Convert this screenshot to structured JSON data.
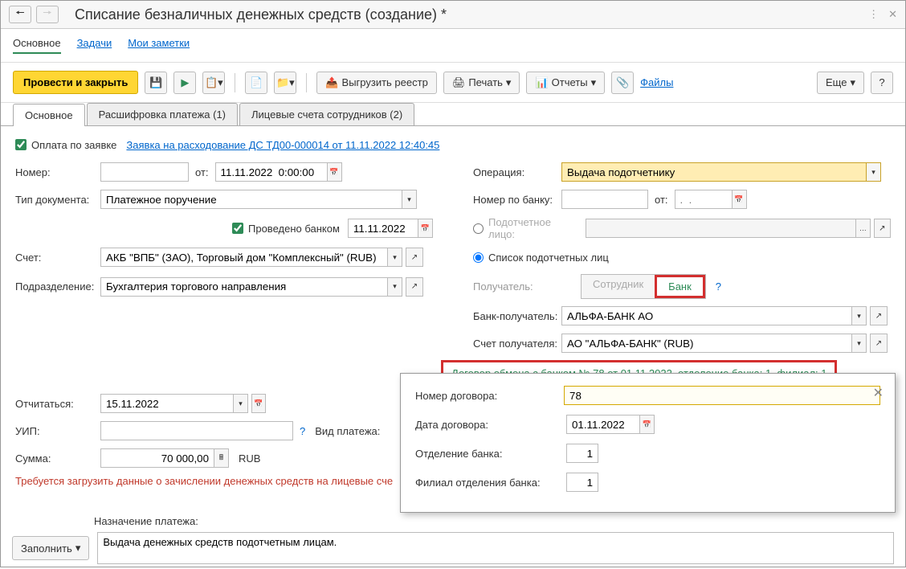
{
  "title": "Списание безналичных денежных средств (создание) *",
  "menu": {
    "main": "Основное",
    "tasks": "Задачи",
    "notes": "Мои заметки"
  },
  "toolbar": {
    "post_close": "Провести и закрыть",
    "export_registry": "Выгрузить реестр",
    "print": "Печать",
    "reports": "Отчеты",
    "files": "Файлы",
    "more": "Еще",
    "help": "?"
  },
  "tabs": {
    "main": "Основное",
    "decoding": "Расшифровка платежа (1)",
    "accounts": "Лицевые счета сотрудников (2)"
  },
  "fields": {
    "pay_by_request_label": "Оплата по заявке",
    "request_link": "Заявка на расходование ДС ТД00-000014 от 11.11.2022 12:40:45",
    "number_label": "Номер:",
    "from_label": "от:",
    "date_value": "11.11.2022  0:00:00",
    "operation_label": "Операция:",
    "operation_value": "Выдача подотчетнику",
    "doc_type_label": "Тип документа:",
    "doc_type_value": "Платежное поручение",
    "bank_number_label": "Номер по банку:",
    "bank_from_label": "от:",
    "bank_date_placeholder": ".  .",
    "processed_by_bank": "Проведено банком",
    "processed_date": "11.11.2022",
    "account_person_label": "Подотчетное лицо:",
    "list_persons_label": "Список подотчетных лиц",
    "account_label": "Счет:",
    "account_value": "АКБ \"ВПБ\" (ЗАО), Торговый дом \"Комплексный\" (RUB)",
    "division_label": "Подразделение:",
    "division_value": "Бухгалтерия торгового направления",
    "recipient_label": "Получатель:",
    "recipient_employee": "Сотрудник",
    "recipient_bank": "Банк",
    "recipient_bank_label": "Банк-получатель:",
    "recipient_bank_value": "АЛЬФА-БАНК АО",
    "recipient_account_label": "Счет получателя:",
    "recipient_account_value": "АО \"АЛЬФА-БАНК\" (RUB)",
    "contract_link": "Договор обмена с банком № 78 от 01.11.2022, отделение банка: 1, филиал: 1",
    "report_label": "Отчитаться:",
    "report_value": "15.11.2022",
    "uip_label": "УИП:",
    "payment_type_label": "Вид платежа:",
    "sum_label": "Сумма:",
    "sum_value": "70 000,00",
    "currency": "RUB",
    "warning": "Требуется загрузить данные о зачислении денежных средств на лицевые сче",
    "purpose_label": "Назначение платежа:",
    "fill_btn": "Заполнить",
    "purpose_value": "Выдача денежных средств подотчетным лицам."
  },
  "popup": {
    "contract_number_label": "Номер договора:",
    "contract_number_value": "78",
    "contract_date_label": "Дата договора:",
    "contract_date_value": "01.11.2022",
    "branch_label": "Отделение банка:",
    "branch_value": "1",
    "subbranch_label": "Филиал отделения банка:",
    "subbranch_value": "1"
  }
}
